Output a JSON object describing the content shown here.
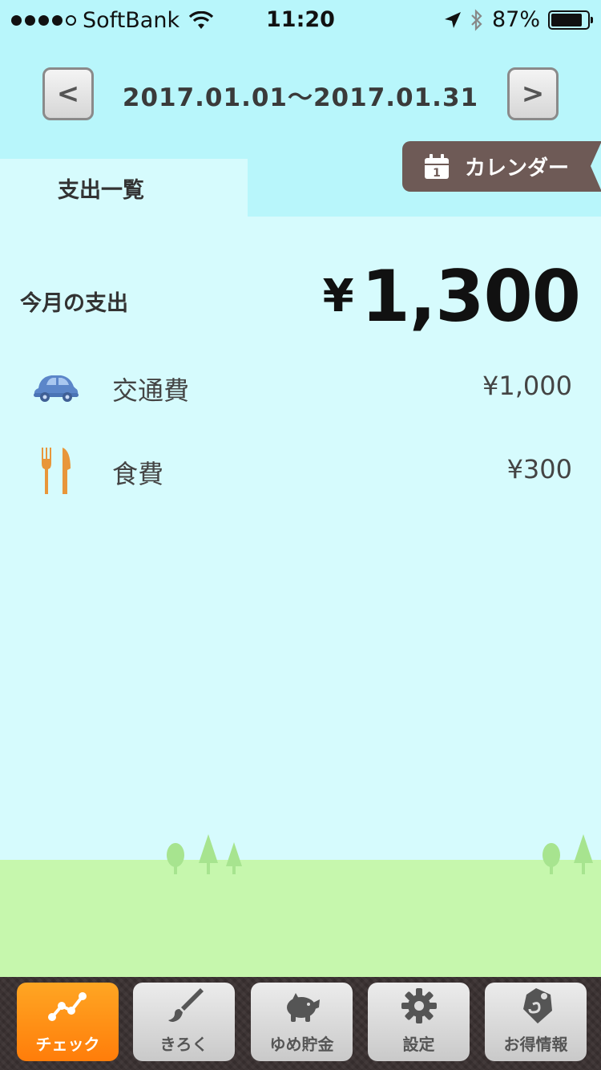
{
  "status_bar": {
    "carrier": "SoftBank",
    "time": "11:20",
    "battery": "87%",
    "battery_level": 0.87
  },
  "header": {
    "prev_label": "<",
    "next_label": ">",
    "period": "2017.01.01〜2017.01.31",
    "calendar_label": "カレンダー",
    "calendar_icon_day": "1",
    "tab_label": "支出一覧"
  },
  "summary": {
    "label": "今月の支出",
    "currency": "¥",
    "amount": "1,300"
  },
  "categories": [
    {
      "name": "交通費",
      "amount": "¥1,000",
      "icon": "car-icon",
      "color": "#5b86c9"
    },
    {
      "name": "食費",
      "amount": "¥300",
      "icon": "fork-knife-icon",
      "color": "#e8963a"
    }
  ],
  "tabbar": {
    "items": [
      {
        "label": "チェック",
        "icon": "chart-line-icon",
        "active": true
      },
      {
        "label": "きろく",
        "icon": "brush-icon",
        "active": false
      },
      {
        "label": "ゆめ貯金",
        "icon": "piggy-bank-icon",
        "active": false
      },
      {
        "label": "設定",
        "icon": "gear-icon",
        "active": false
      },
      {
        "label": "お得情報",
        "icon": "price-tag-icon",
        "active": false
      }
    ]
  },
  "colors": {
    "header_bg": "#b8f6fb",
    "body_bg": "#d6fbfd",
    "grass": "#c6f7ad",
    "calendar_button": "#6e5a56",
    "active_tab": "#ff8c14"
  }
}
